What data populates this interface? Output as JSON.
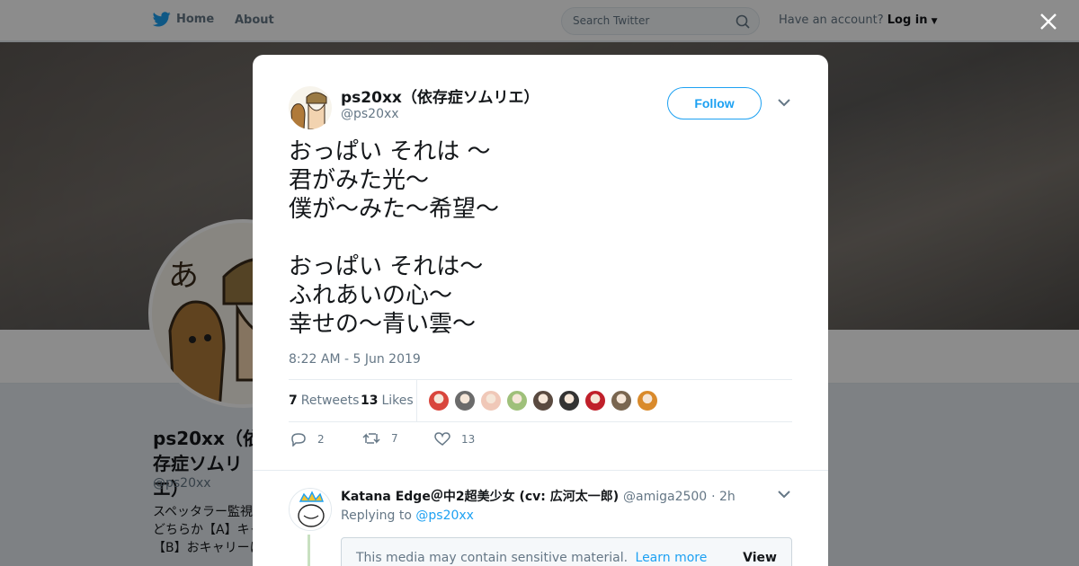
{
  "nav": {
    "home_label": "Home",
    "about_label": "About",
    "search_placeholder": "Search Twitter",
    "account_prompt": "Have an account?",
    "login_label": "Log in"
  },
  "profile": {
    "name": "ps20xx（依存症ソムリエ）",
    "handle": "@ps20xx",
    "bio": "スペッタラー監視\nどちらか【A】キャ\n【B】おキャリーに"
  },
  "tweet": {
    "author_name": "ps20xx（依存症ソムリエ）",
    "author_handle": "@ps20xx",
    "follow_label": "Follow",
    "text": "おっぱい それは 〜\n君がみた光〜\n僕が〜みた〜希望〜\n\nおっぱい それは〜\nふれあいの心〜\n幸せの〜青い雲〜",
    "timestamp": "8:22 AM - 5 Jun 2019",
    "retweets_count": "7",
    "retweets_label": "Retweets",
    "likes_count": "13",
    "likes_label": "Likes",
    "liker_colors": [
      "#d9463c",
      "#6b6b6b",
      "#f0c8b8",
      "#9fc07a",
      "#5a4a40",
      "#333333",
      "#c0202a",
      "#7a6650",
      "#d98a2b"
    ],
    "reply_count": "2",
    "retweet_action_count": "7",
    "like_action_count": "13"
  },
  "reply": {
    "author_name": "Katana Edge＠中2超美少女 (cv: 広河太一郎)",
    "author_handle": "@amiga2500",
    "age": "· 2h",
    "replying_prefix": "Replying to",
    "replying_to": "@ps20xx",
    "sensitive_text": "This media may contain sensitive material.",
    "learn_more": "Learn more",
    "view_label": "View"
  },
  "colors": {
    "brand": "#1da1f2",
    "secondary_text": "#657786"
  }
}
